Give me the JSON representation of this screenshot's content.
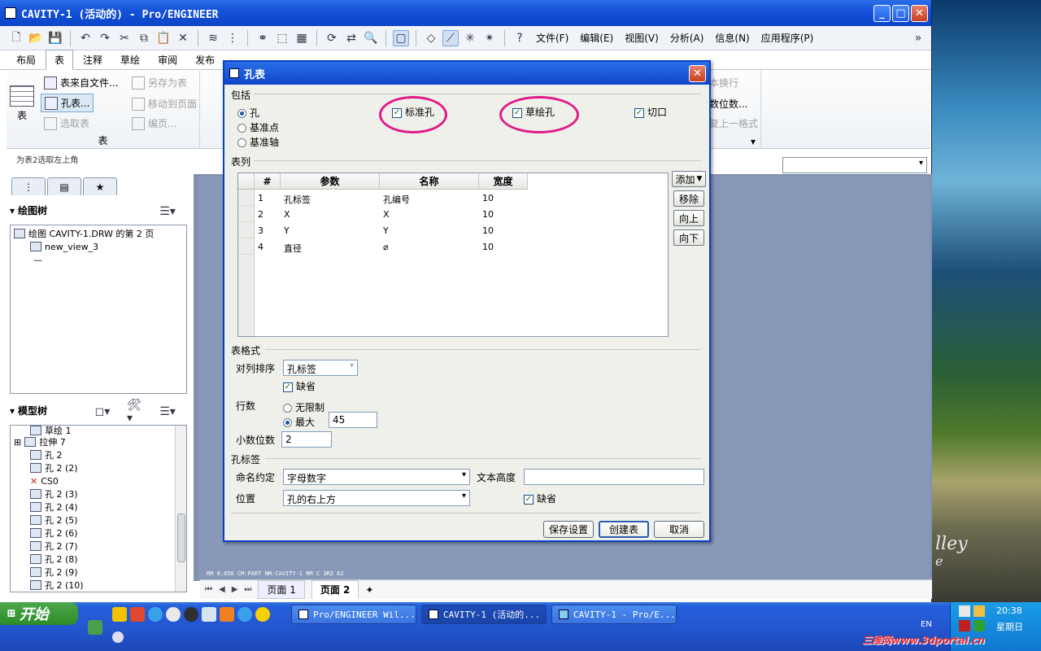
{
  "window": {
    "title": "CAVITY-1 (活动的) - Pro/ENGINEER"
  },
  "menus": [
    "文件(F)",
    "编辑(E)",
    "视图(V)",
    "分析(A)",
    "信息(N)",
    "应用程序(P)"
  ],
  "tabs": [
    "布局",
    "表",
    "注释",
    "草绘",
    "审阅",
    "发布"
  ],
  "ribbon": {
    "table_label": "表",
    "from_file": "表来自文件...",
    "save_as": "另存为表",
    "hole_table": "孔表...",
    "move_to_page": "移动到页面",
    "select_table": "选取表",
    "paginate": "编页...",
    "group_footer": "表",
    "wrap": "本换行",
    "decimals": "数位数...",
    "format": "复上一格式"
  },
  "status_text": "为表2选取左上角",
  "left_panel": {
    "drawing_tree_header": "绘图树",
    "drawing_tree_items": [
      "绘图 CAVITY-1.DRW 的第 2 页",
      "new_view_3",
      "—"
    ],
    "model_tree_header": "模型树",
    "model_tree_items": [
      "草绘 1",
      "拉伸 7",
      "孔 2",
      "孔 2 (2)",
      "CS0",
      "孔 2 (3)",
      "孔 2 (4)",
      "孔 2 (5)",
      "孔 2 (6)",
      "孔 2 (7)",
      "孔 2 (8)",
      "孔 2 (9)",
      "孔 2 (10)"
    ]
  },
  "canvas_info": "RM 0.650  CM:PART  NM:CAVITY-1  RM C  3R2 62",
  "pages": [
    "页面 1",
    "页面 2"
  ],
  "dialog": {
    "title": "孔表",
    "include_label": "包括",
    "radio_hole": "孔",
    "radio_datum_point": "基准点",
    "radio_datum_axis": "基准轴",
    "chk_standard_hole": "标准孔",
    "chk_sketch_hole": "草绘孔",
    "chk_cut": "切口",
    "columns_label": "表列",
    "grid_headers": [
      "#",
      "参数",
      "名称",
      "宽度"
    ],
    "grid_rows": [
      [
        "1",
        "孔标签",
        "孔编号",
        "10"
      ],
      [
        "2",
        "X",
        "X",
        "10"
      ],
      [
        "3",
        "Y",
        "Y",
        "10"
      ],
      [
        "4",
        "直径",
        "⌀",
        "10"
      ]
    ],
    "btn_add": "添加",
    "btn_remove": "移除",
    "btn_up": "向上",
    "btn_down": "向下",
    "format_label": "表格式",
    "sort_label": "对列排序",
    "sort_value": "孔标签",
    "default_chk": "缺省",
    "rows_label": "行数",
    "rows_unlimited": "无限制",
    "rows_max": "最大",
    "rows_max_value": "45",
    "decimals_label": "小数位数",
    "decimals_value": "2",
    "hole_label_section": "孔标签",
    "naming_label": "命名约定",
    "naming_value": "字母数字",
    "text_height_label": "文本高度",
    "text_height_value": "",
    "position_label": "位置",
    "position_value": "孔的右上方",
    "position_default": "缺省",
    "btn_save": "保存设置",
    "btn_create": "创建表",
    "btn_cancel": "取消"
  },
  "taskbar": {
    "start": "开始",
    "items": [
      "Pro/ENGINEER Wil...",
      "CAVITY-1 (活动的...",
      "CAVITY-1 - Pro/E..."
    ],
    "lang": "EN",
    "time": "20:38",
    "day": "星期日",
    "watermark": "三维网www.3dportal.cn"
  },
  "wallpaper_text": "lley",
  "wallpaper_text2": "e",
  "colors": {
    "highlight_ring": "#e01a8a",
    "titlebar": "#0c45c8"
  }
}
